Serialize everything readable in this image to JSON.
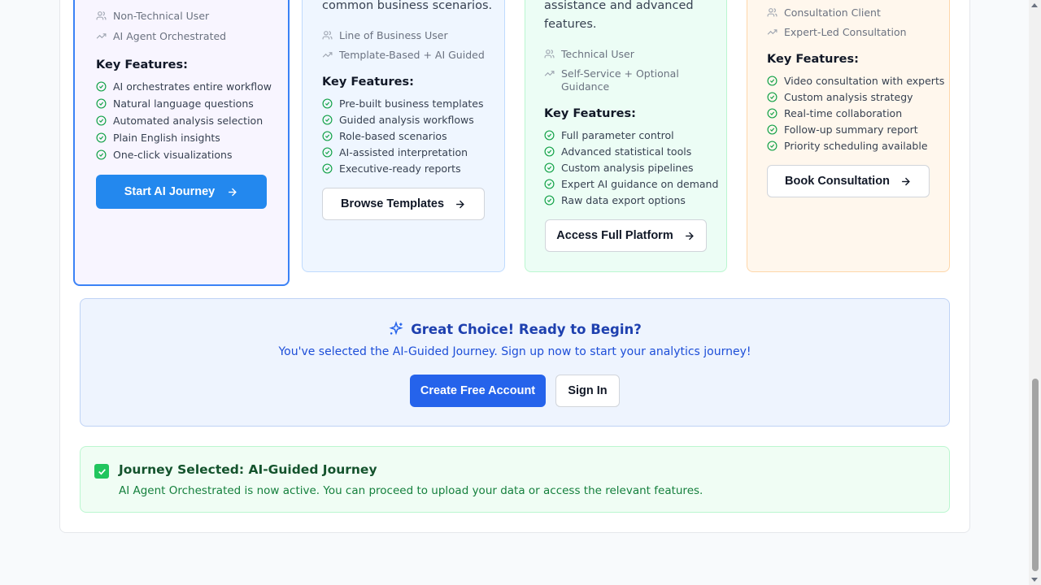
{
  "cards": [
    {
      "desc_lines": [],
      "audience": "Non-Technical User",
      "mode": "AI Agent Orchestrated",
      "key_features_label": "Key Features:",
      "features": [
        "AI orchestrates entire workflow",
        "Natural language questions",
        "Automated analysis selection",
        "Plain English insights",
        "One-click visualizations"
      ],
      "button_label": "Start AI Journey"
    },
    {
      "desc_lines": [
        "common business scenarios."
      ],
      "audience": "Line of Business User",
      "mode": "Template-Based + AI Guided",
      "key_features_label": "Key Features:",
      "features": [
        "Pre-built business templates",
        "Guided analysis workflows",
        "Role-based scenarios",
        "AI-assisted interpretation",
        "Executive-ready reports"
      ],
      "button_label": "Browse Templates"
    },
    {
      "desc_lines": [
        "assistance and advanced",
        "features."
      ],
      "audience": "Technical User",
      "mode_lines": [
        "Self-Service + Optional",
        "Guidance"
      ],
      "key_features_label": "Key Features:",
      "features": [
        "Full parameter control",
        "Advanced statistical tools",
        "Custom analysis pipelines",
        "Expert AI guidance on demand",
        "Raw data export options"
      ],
      "button_label": "Access Full Platform"
    },
    {
      "desc_lines": [],
      "audience": "Consultation Client",
      "mode": "Expert-Led Consultation",
      "key_features_label": "Key Features:",
      "features": [
        "Video consultation with experts",
        "Custom analysis strategy",
        "Real-time collaboration",
        "Follow-up summary report",
        "Priority scheduling available"
      ],
      "button_label": "Book Consultation"
    }
  ],
  "cta": {
    "title": "Great Choice! Ready to Begin?",
    "subtitle": "You've selected the AI-Guided Journey. Sign up now to start your analytics journey!",
    "create_label": "Create Free Account",
    "signin_label": "Sign In"
  },
  "selected": {
    "title": "Journey Selected: AI-Guided Journey",
    "subtitle": "AI Agent Orchestrated is now active. You can proceed to upload your data or access the relevant features."
  },
  "icons": {
    "user": "users-icon",
    "trend": "trending-up-icon",
    "check": "check-circle-icon",
    "arrow": "arrow-right-icon",
    "sparkle": "sparkles-icon",
    "selected": "check-box-icon"
  },
  "colors": {
    "primary": "#2388ee",
    "selected_border": "#3b82f6",
    "check_green": "#16a34a",
    "cta_title": "#1e40af"
  }
}
